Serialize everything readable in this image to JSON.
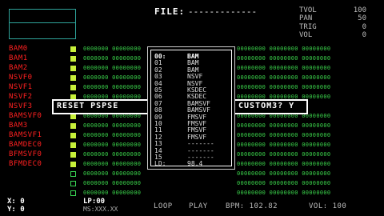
{
  "header": {
    "file_label": "FILE:",
    "file_value": "-------------"
  },
  "params": [
    {
      "name": "TVOL",
      "value": "100"
    },
    {
      "name": "PAN",
      "value": "50"
    },
    {
      "name": "TRIG",
      "value": "0"
    },
    {
      "name": "VOL",
      "value": "0"
    }
  ],
  "tracks": [
    {
      "name": "BAM0",
      "marker": "filled",
      "left": "0000000 00000000",
      "right": "00000000 00000000 00000000"
    },
    {
      "name": "BAM1",
      "marker": "filled",
      "left": "0000000 00000000",
      "right": "00000000 00000000 00000000"
    },
    {
      "name": "BAM2",
      "marker": "filled",
      "left": "0000000 00000000",
      "right": "00000000 00000000 00000000"
    },
    {
      "name": "NSVF0",
      "marker": "filled",
      "left": "0000000 00000000",
      "right": "00000000 00000000 00000000"
    },
    {
      "name": "NSVF1",
      "marker": "filled",
      "left": "0000000 00000000",
      "right": "00000000 00000000 00000000"
    },
    {
      "name": "NSVF2",
      "marker": "filled",
      "left": "0000000 00000000",
      "right": "00000000 00000000 00000000"
    },
    {
      "name": "NSVF3",
      "marker": "filled",
      "left": "",
      "right": ""
    },
    {
      "name": "BAMSVF0",
      "marker": "filled",
      "left": "0000000 00000000",
      "right": "00000000 00000000 00000000"
    },
    {
      "name": "BAM3",
      "marker": "filled",
      "left": "0000000 00000000",
      "right": "00000000 00000000 00000000"
    },
    {
      "name": "BAMSVF1",
      "marker": "filled",
      "left": "0000000 00000000",
      "right": "00000000 00000000 00000000"
    },
    {
      "name": "BAMDEC0",
      "marker": "filled",
      "left": "0000000 00000000",
      "right": "00000000 00000000 00000000"
    },
    {
      "name": "BFMSVF0",
      "marker": "filled",
      "left": "0000000 00000000",
      "right": "00000000 00000000 00000000"
    },
    {
      "name": "BFMDEC0",
      "marker": "filled",
      "left": "0000000 00000000",
      "right": "00000000 00000000 00000000"
    },
    {
      "name": "",
      "marker": "empty",
      "left": "0000000 00000000",
      "right": "00000000 00000000 00000000"
    },
    {
      "name": "",
      "marker": "empty",
      "left": "0000000 00000000",
      "right": "00000000 00000000 00000000"
    },
    {
      "name": "",
      "marker": "empty",
      "left": "0000000 00000000",
      "right": "00000000 00000000 00000000"
    }
  ],
  "dialog": {
    "left": "RESET PSPSE",
    "right": "CUSTOM3? Y"
  },
  "list": [
    {
      "num": "00:",
      "label": "BAM",
      "style": "sel"
    },
    {
      "num": "01",
      "label": "BAM",
      "style": "dim"
    },
    {
      "num": "02",
      "label": "BAM",
      "style": "dim"
    },
    {
      "num": "03",
      "label": "NSVF",
      "style": "dim"
    },
    {
      "num": "04",
      "label": "NSVF",
      "style": "dim"
    },
    {
      "num": "05",
      "label": "KSDEC",
      "style": "dim"
    },
    {
      "num": "06",
      "label": "KSDEC",
      "style": "dim"
    },
    {
      "num": "07",
      "label": "BAMSVF",
      "style": "dim"
    },
    {
      "num": "08",
      "label": "BAMSVF",
      "style": "dim"
    },
    {
      "num": "09",
      "label": "FMSVF",
      "style": "dim"
    },
    {
      "num": "10",
      "label": "FMSVF",
      "style": "dim"
    },
    {
      "num": "11",
      "label": "FMSVF",
      "style": "dim"
    },
    {
      "num": "12",
      "label": "FMSVF",
      "style": "dim"
    },
    {
      "num": "13",
      "label": "-------",
      "style": "dim"
    },
    {
      "num": "14",
      "label": "-------",
      "style": "dim"
    },
    {
      "num": "15",
      "label": "-------",
      "style": "dim"
    },
    {
      "num": "LD:",
      "label": "98.4",
      "style": "dim"
    }
  ],
  "footer": {
    "x": "X: 0",
    "y": "Y: 0",
    "lp": "LP:00",
    "ms": "MS:XXX.XX",
    "loop": "LOOP",
    "play": "PLAY",
    "bpm": "BPM: 102.82",
    "vol": "VOL: 100"
  },
  "colors": {
    "track_name": "#ff2020",
    "pattern": "#3ad14a",
    "marker": "#c7f03a",
    "box_border": "#2ea39a"
  }
}
